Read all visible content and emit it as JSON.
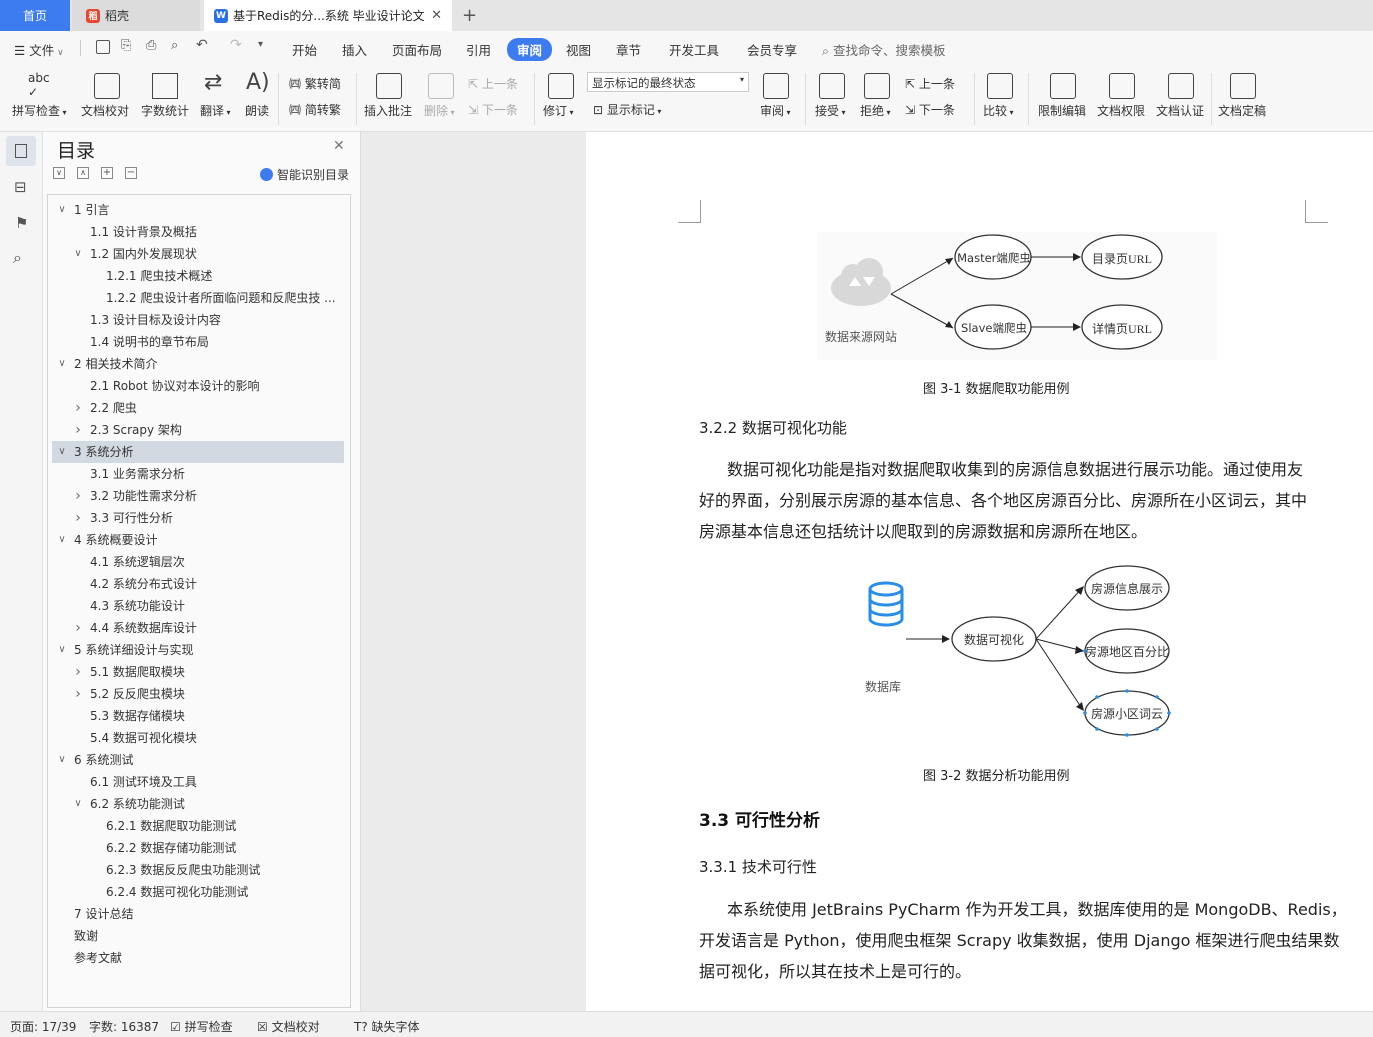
{
  "tabs": {
    "home": "首页",
    "daoke": "稻壳",
    "doc": "基于Redis的分...系统 毕业设计论文",
    "add": "+"
  },
  "menu": {
    "file": "文件",
    "items": [
      "开始",
      "插入",
      "页面布局",
      "引用",
      "审阅",
      "视图",
      "章节",
      "开发工具",
      "会员专享"
    ],
    "active": "审阅",
    "search": "查找命令、搜索模板"
  },
  "ribbon": {
    "spell": "拼写检查",
    "proof": "文档校对",
    "wordcount": "字数统计",
    "translate": "翻译",
    "read": "朗读",
    "trad": "繁转简",
    "simp": "简转繁",
    "insert_comment": "插入批注",
    "delete": "删除",
    "prev_c": "上一条",
    "next_c": "下一条",
    "revise": "修订",
    "markup_state": "显示标记的最终状态",
    "show_markup": "显示标记",
    "review": "审阅",
    "accept": "接受",
    "reject": "拒绝",
    "prev": "上一条",
    "next": "下一条",
    "compare": "比较",
    "restrict": "限制编辑",
    "permission": "文档权限",
    "certify": "文档认证",
    "finalize": "文档定稿"
  },
  "nav": {
    "title": "目录",
    "smart": "智能识别目录"
  },
  "toc": [
    {
      "t": "1  引言",
      "lv": 0,
      "ex": "v"
    },
    {
      "t": "1.1  设计背景及概括",
      "lv": 1
    },
    {
      "t": "1.2  国内外发展现状",
      "lv": 1,
      "ex": "v"
    },
    {
      "t": "1.2.1  爬虫技术概述",
      "lv": 2
    },
    {
      "t": "1.2.2  爬虫设计者所面临问题和反爬虫技 ...",
      "lv": 2
    },
    {
      "t": "1.3  设计目标及设计内容",
      "lv": 1
    },
    {
      "t": "1.4  说明书的章节布局",
      "lv": 1
    },
    {
      "t": "2  相关技术简介",
      "lv": 0,
      "ex": "v"
    },
    {
      "t": "2.1 Robot 协议对本设计的影响",
      "lv": 1
    },
    {
      "t": "2.2  爬虫",
      "lv": 1,
      "ex": ">"
    },
    {
      "t": "2.3 Scrapy 架构",
      "lv": 1,
      "ex": ">"
    },
    {
      "t": "3  系统分析",
      "lv": 0,
      "ex": "v",
      "sel": true
    },
    {
      "t": "3.1  业务需求分析",
      "lv": 1
    },
    {
      "t": "3.2  功能性需求分析",
      "lv": 1,
      "ex": ">"
    },
    {
      "t": "3.3  可行性分析",
      "lv": 1,
      "ex": ">"
    },
    {
      "t": "4  系统概要设计",
      "lv": 0,
      "ex": "v"
    },
    {
      "t": "4.1  系统逻辑层次",
      "lv": 1
    },
    {
      "t": "4.2  系统分布式设计",
      "lv": 1
    },
    {
      "t": "4.3  系统功能设计",
      "lv": 1
    },
    {
      "t": "4.4  系统数据库设计",
      "lv": 1,
      "ex": ">"
    },
    {
      "t": "5  系统详细设计与实现",
      "lv": 0,
      "ex": "v"
    },
    {
      "t": "5.1  数据爬取模块",
      "lv": 1,
      "ex": ">"
    },
    {
      "t": "5.2  反反爬虫模块",
      "lv": 1,
      "ex": ">"
    },
    {
      "t": "5.3  数据存储模块",
      "lv": 1
    },
    {
      "t": "5.4  数据可视化模块",
      "lv": 1
    },
    {
      "t": "6  系统测试",
      "lv": 0,
      "ex": "v"
    },
    {
      "t": "6.1  测试环境及工具",
      "lv": 1
    },
    {
      "t": "6.2  系统功能测试",
      "lv": 1,
      "ex": "v"
    },
    {
      "t": "6.2.1  数据爬取功能测试",
      "lv": 2
    },
    {
      "t": "6.2.2  数据存储功能测试",
      "lv": 2
    },
    {
      "t": "6.2.3  数据反反爬虫功能测试",
      "lv": 2
    },
    {
      "t": "6.2.4  数据可视化功能测试",
      "lv": 2
    },
    {
      "t": "7  设计总结",
      "lv": 0
    },
    {
      "t": "致谢",
      "lv": 0
    },
    {
      "t": "参考文献",
      "lv": 0
    }
  ],
  "doc": {
    "fig1": {
      "cloud": "数据来源网站",
      "master": "Master端爬虫",
      "slave": "Slave端爬虫",
      "list_url": "目录页URL",
      "detail_url": "详情页URL",
      "caption": "图 3-1  数据爬取功能用例"
    },
    "h322": "3.2.2  数据可视化功能",
    "p1": [
      "数据可视化功能是指对数据爬取收集到的房源信息数据进行展示功能。通过使用友",
      "好的界面，分别展示房源的基本信息、各个地区房源百分比、房源所在小区词云，其中",
      "房源基本信息还包括统计以爬取到的房源数据和房源所在地区。"
    ],
    "fig2": {
      "db": "数据库",
      "vis": "数据可视化",
      "info": "房源信息展示",
      "pct": "房源地区百分比",
      "cloud": "房源小区词云",
      "caption": "图 3-2  数据分析功能用例"
    },
    "h33": "3.3  可行性分析",
    "h331": "3.3.1  技术可行性",
    "p2": [
      "本系统使用 JetBrains PyCharm 作为开发工具，数据库使用的是 MongoDB、Redis，",
      "开发语言是 Python，使用爬虫框架 Scrapy 收集数据，使用 Django 框架进行爬虫结果数",
      "据可视化，所以其在技术上是可行的。"
    ]
  },
  "status": {
    "page": "页面: 17/39",
    "words": "字数: 16387",
    "spell": "拼写检查",
    "proof": "文档校对",
    "missing": "缺失字体"
  },
  "colors": {
    "accent": "#3d7bf0",
    "selected": "#d3d9e1",
    "db_blue": "#2a8de8"
  }
}
